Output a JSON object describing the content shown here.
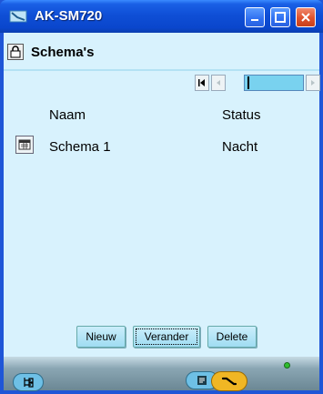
{
  "window": {
    "title": "AK-SM720",
    "controls": [
      "minimize-icon",
      "maximize-icon",
      "close-icon"
    ],
    "accent_color": "#0a46cc"
  },
  "screen": {
    "title": "Schema's",
    "lock_icon": "padlock-icon"
  },
  "pager": {
    "icons": [
      "first-page-icon",
      "prev-page-icon",
      "next-page-icon"
    ]
  },
  "table": {
    "columns": [
      "Naam",
      "Status"
    ],
    "rows": [
      {
        "icon": "calendar-icon",
        "name": "Schema 1",
        "status": "Nacht"
      }
    ]
  },
  "buttons": {
    "new": "Nieuw",
    "edit": "Verander",
    "delete": "Delete"
  },
  "footer": {
    "icons": [
      "network-icon",
      "notepad-icon",
      "wrench-icon"
    ],
    "led_color": "#2fbe2f"
  }
}
